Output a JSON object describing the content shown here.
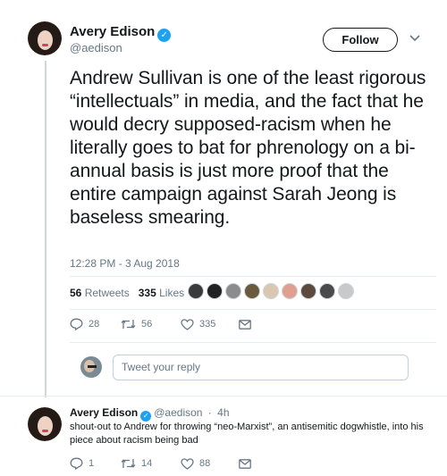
{
  "tweet": {
    "author": {
      "name": "Avery Edison",
      "handle": "@aedison"
    },
    "follow_label": "Follow",
    "text": "Andrew Sullivan is one of the least rigorous “intellectuals” in media, and the fact that he would decry supposed-racism when he literally goes to bat for phrenology on a bi-annual basis is just more proof that the entire campaign against Sarah Jeong is baseless smearing.",
    "timestamp": "12:28 PM - 3 Aug 2018",
    "retweets": {
      "count": "56",
      "label": "Retweets"
    },
    "likes": {
      "count": "335",
      "label": "Likes"
    },
    "actions": {
      "reply": "28",
      "retweet": "56",
      "like": "335"
    }
  },
  "reply_box": {
    "placeholder": "Tweet your reply"
  },
  "reply": {
    "author": {
      "name": "Avery Edison",
      "handle": "@aedison",
      "time": "4h"
    },
    "text": "shout-out to Andrew for throwing “neo-Marxist”, an antisemitic dogwhistle, into his piece about racism being bad",
    "actions": {
      "reply": "1",
      "retweet": "14",
      "like": "88"
    }
  },
  "colors": {
    "accent": "#1da1f2",
    "text": "#14171a",
    "secondary": "#657786",
    "border": "#e6ecf0"
  },
  "icons": [
    "verified-badge-icon",
    "chevron-down-icon",
    "reply-icon",
    "retweet-icon",
    "like-icon",
    "direct-message-icon"
  ]
}
